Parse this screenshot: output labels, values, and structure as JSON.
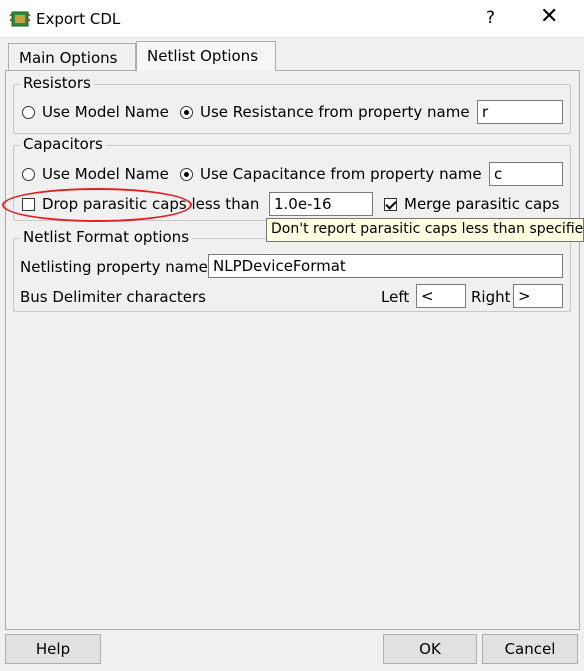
{
  "window": {
    "title": "Export CDL",
    "help_glyph": "?",
    "close_glyph": "✕"
  },
  "tabs": [
    {
      "label": "Main Options",
      "active": false
    },
    {
      "label": "Netlist Options",
      "active": true
    }
  ],
  "resistors": {
    "legend": "Resistors",
    "opt_model": "Use Model Name",
    "opt_prop": "Use Resistance from property name",
    "selected": "opt_prop",
    "prop_value": "r"
  },
  "capacitors": {
    "legend": "Capacitors",
    "opt_model": "Use Model Name",
    "opt_prop": "Use Capacitance from property name",
    "selected": "opt_prop",
    "prop_value": "c",
    "drop_label": "Drop parasitic caps less than",
    "drop_checked": false,
    "drop_value": "1.0e-16",
    "merge_label": "Merge parasitic caps",
    "merge_checked": true
  },
  "tooltip": "Don't report parasitic caps less than specified lim",
  "netlist_format": {
    "legend": "Netlist Format options",
    "prop_label": "Netlisting property name",
    "prop_value": "NLPDeviceFormat",
    "bus_label": "Bus Delimiter characters",
    "left_label": "Left",
    "left_value": "<",
    "right_label": "Right",
    "right_value": ">"
  },
  "buttons": {
    "help": "Help",
    "ok": "OK",
    "cancel": "Cancel"
  },
  "colors": {
    "annotation": "#e02020",
    "tooltip_bg": "#ffffe1"
  }
}
